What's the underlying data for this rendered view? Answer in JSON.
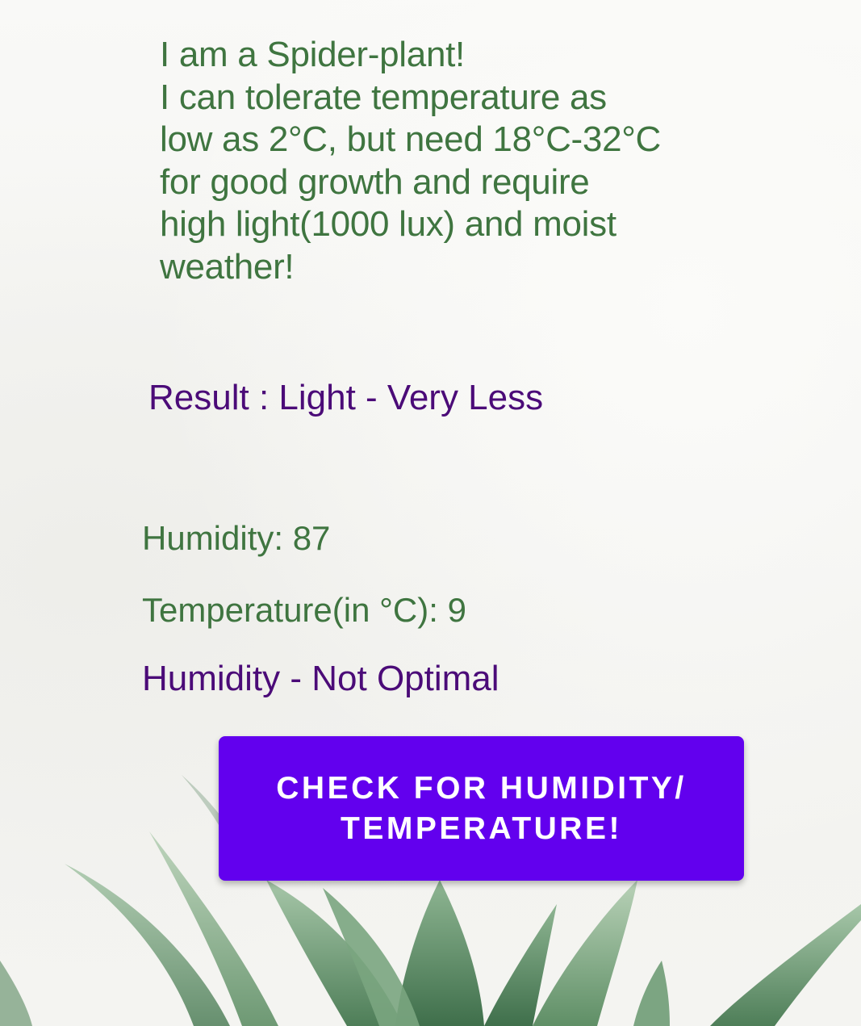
{
  "plant_info": {
    "lines": [
      "I am a Spider-plant!",
      "I can tolerate temperature as",
      "low as 2°C, but need 18°C-32°C",
      "for good growth and require",
      "high light(1000 lux) and moist",
      "weather!"
    ]
  },
  "light_result": "Result : Light - Very Less",
  "readings": {
    "humidity": "Humidity: 87",
    "temperature": "Temperature(in °C): 9"
  },
  "humidity_status": "Humidity - Not Optimal",
  "check_button": {
    "line1": "CHECK FOR HUMIDITY/",
    "line2": "TEMPERATURE!"
  },
  "colors": {
    "info_text": "#3f7540",
    "result_text": "#4b0b78",
    "button": "#6200ee",
    "button_text": "#ffffff"
  }
}
